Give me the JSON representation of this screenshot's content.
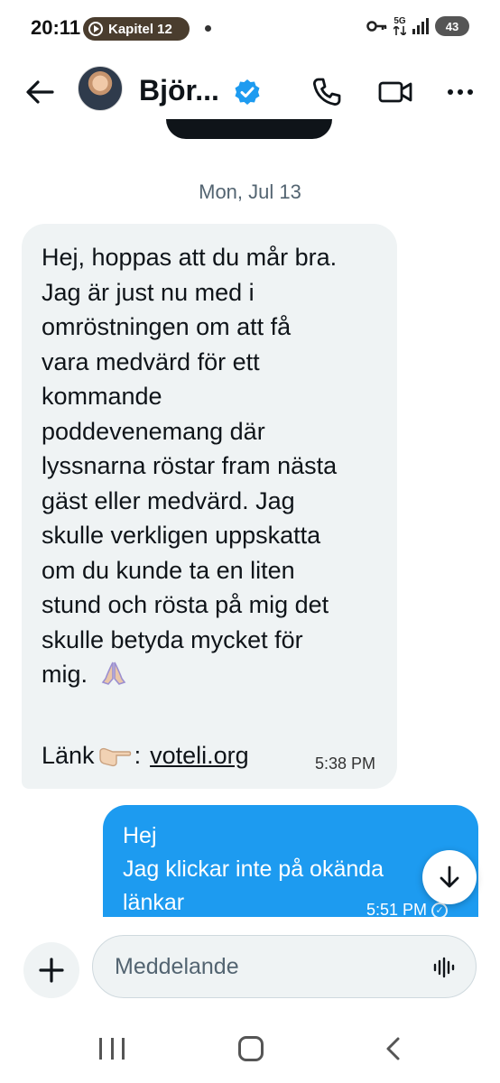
{
  "status_bar": {
    "time": "20:11",
    "chapter_label": "Kapitel 12",
    "network": "5G",
    "battery": "43"
  },
  "header": {
    "contact_name": "Björ...",
    "verified": true,
    "accent_color": "#1d9bf0",
    "icons": [
      "back-arrow-icon",
      "verified-badge-icon",
      "phone-icon",
      "video-camera-icon",
      "more-icon"
    ]
  },
  "conversation": {
    "date_separator": "Mon, Jul 13",
    "incoming": {
      "lines": [
        "Hej, hoppas att du mår bra.",
        "Jag är just nu med i",
        "omröstningen om att få",
        "vara medvärd för ett",
        "kommande",
        "poddevenemang där",
        "lyssnarna röstar fram nästa",
        "gäst eller medvärd. Jag",
        "skulle verkligen uppskatta",
        "om du kunde ta en liten",
        "stund och rösta på mig det",
        "skulle betyda mycket för",
        "mig."
      ],
      "link_prefix": "Länk",
      "link_separator": ":",
      "link_url": "voteli.org",
      "time": "5:38 PM",
      "bubble_color": "#eff3f4"
    },
    "outgoing": {
      "lines": [
        "Hej",
        "Jag klickar inte på okända",
        "länkar"
      ],
      "time": "5:51 PM",
      "bubble_color": "#1d9bf0"
    }
  },
  "composer": {
    "placeholder": "Meddelande"
  }
}
